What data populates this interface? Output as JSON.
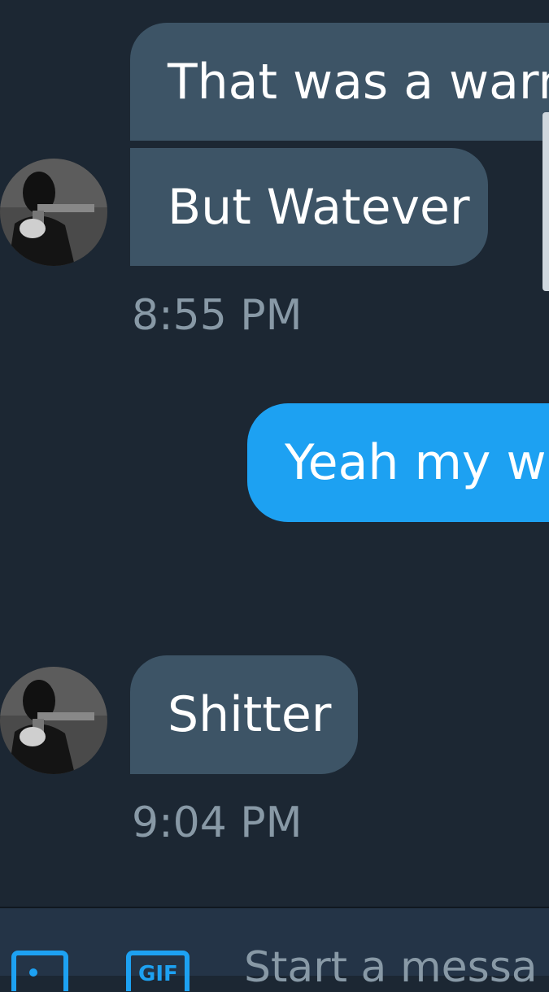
{
  "messages": [
    {
      "direction": "received",
      "text": "That was a warn"
    },
    {
      "direction": "received",
      "text": "But Watever"
    },
    {
      "direction": "sent",
      "text": "Yeah my wa"
    },
    {
      "direction": "received",
      "text": "Shitter"
    }
  ],
  "timestamps": [
    "8:55 PM",
    "9:04 PM"
  ],
  "composer": {
    "placeholder": "Start a messa",
    "image_icon": "image-icon",
    "gif_icon": "gif-icon",
    "gif_label": "GIF"
  },
  "colors": {
    "background": "#1c2733",
    "received_bubble": "#3d5466",
    "sent_bubble": "#1da1f2",
    "timestamp": "#8899a6",
    "accent": "#1da1f2"
  }
}
